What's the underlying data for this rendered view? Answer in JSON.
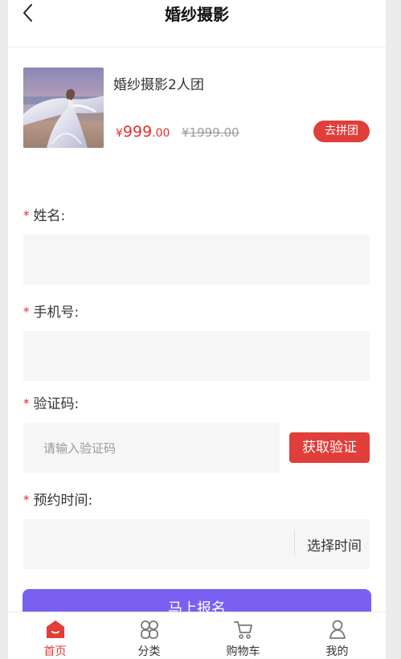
{
  "header": {
    "title": "婚纱摄影"
  },
  "product": {
    "name": "婚纱摄影2人团",
    "price_currency": "¥",
    "price_integer": "999",
    "price_decimal": ".00",
    "original_price": "¥1999.00",
    "action_label": "去拼团"
  },
  "form": {
    "required_mark": "*",
    "name_label": "姓名:",
    "phone_label": "手机号:",
    "code_label": "验证码:",
    "code_placeholder": "请输入验证码",
    "code_button": "获取验证",
    "time_label": "预约时间:",
    "time_select_label": "选择时间",
    "submit_label": "马上报名"
  },
  "tabbar": {
    "items": [
      {
        "label": "首页",
        "icon": "home-icon",
        "active": true
      },
      {
        "label": "分类",
        "icon": "category-icon",
        "active": false
      },
      {
        "label": "购物车",
        "icon": "cart-icon",
        "active": false
      },
      {
        "label": "我的",
        "icon": "user-icon",
        "active": false
      }
    ]
  },
  "colors": {
    "accent_red": "#e03e3a",
    "submit_purple": "#7a60f2",
    "field_background": "#f6f6f6"
  }
}
